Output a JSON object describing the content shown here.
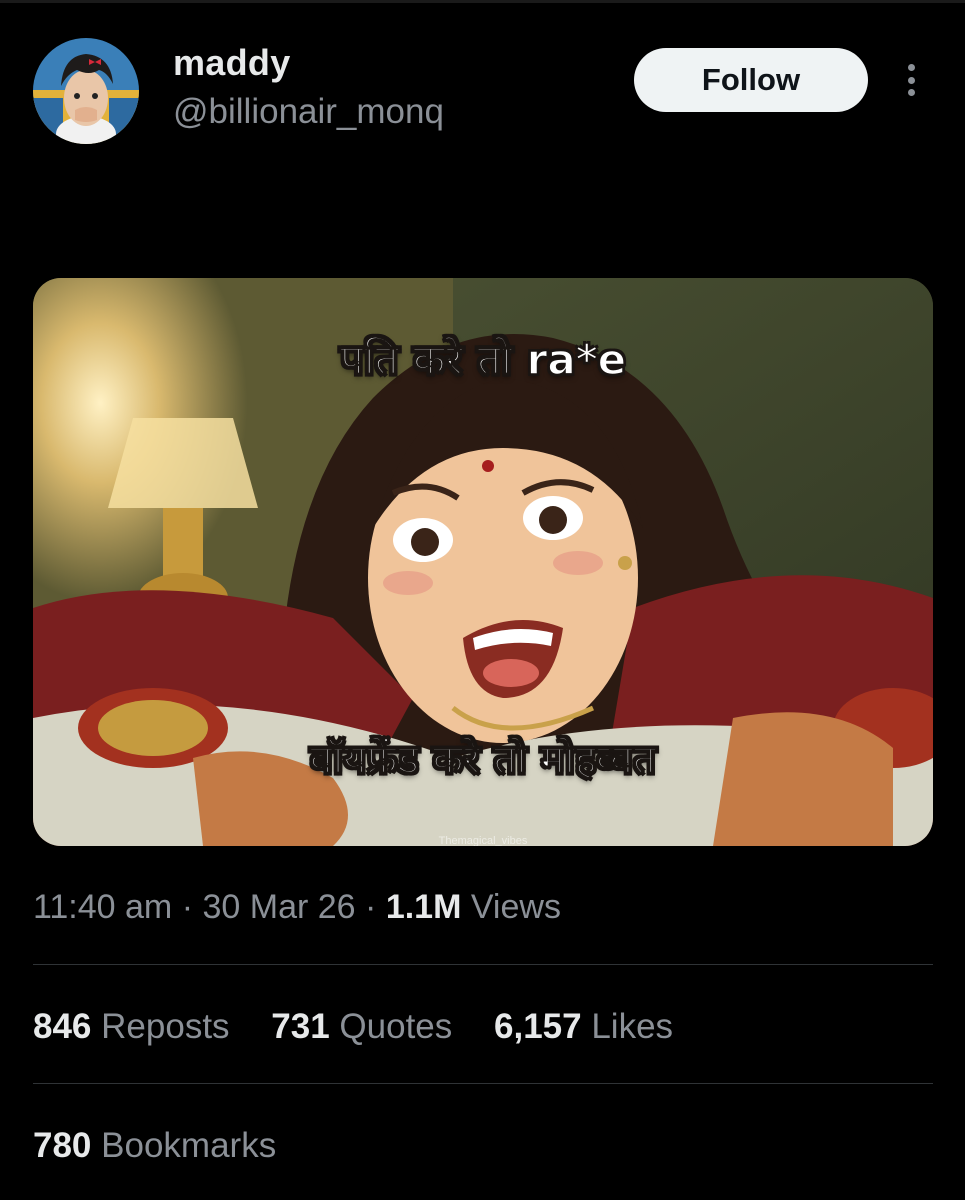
{
  "user": {
    "display_name": "maddy",
    "handle": "@billionair_monq"
  },
  "actions": {
    "follow_label": "Follow"
  },
  "media": {
    "caption_top": "पति करे तो ra*e",
    "caption_bottom": "बॉयफ्रेंड करे तो मोहब्बत",
    "watermark": "Themagical_vibes"
  },
  "meta": {
    "time": "11:40 am",
    "date": "30 Mar 26",
    "views_count": "1.1M",
    "views_label": "Views",
    "separator": "·"
  },
  "stats": {
    "reposts_count": "846",
    "reposts_label": "Reposts",
    "quotes_count": "731",
    "quotes_label": "Quotes",
    "likes_count": "6,157",
    "likes_label": "Likes",
    "bookmarks_count": "780",
    "bookmarks_label": "Bookmarks"
  },
  "colors": {
    "background": "#000000",
    "primary_text": "#e7e9ea",
    "secondary_text": "#8b9097",
    "divider": "#2f3336",
    "follow_button_bg": "#eff3f4"
  }
}
